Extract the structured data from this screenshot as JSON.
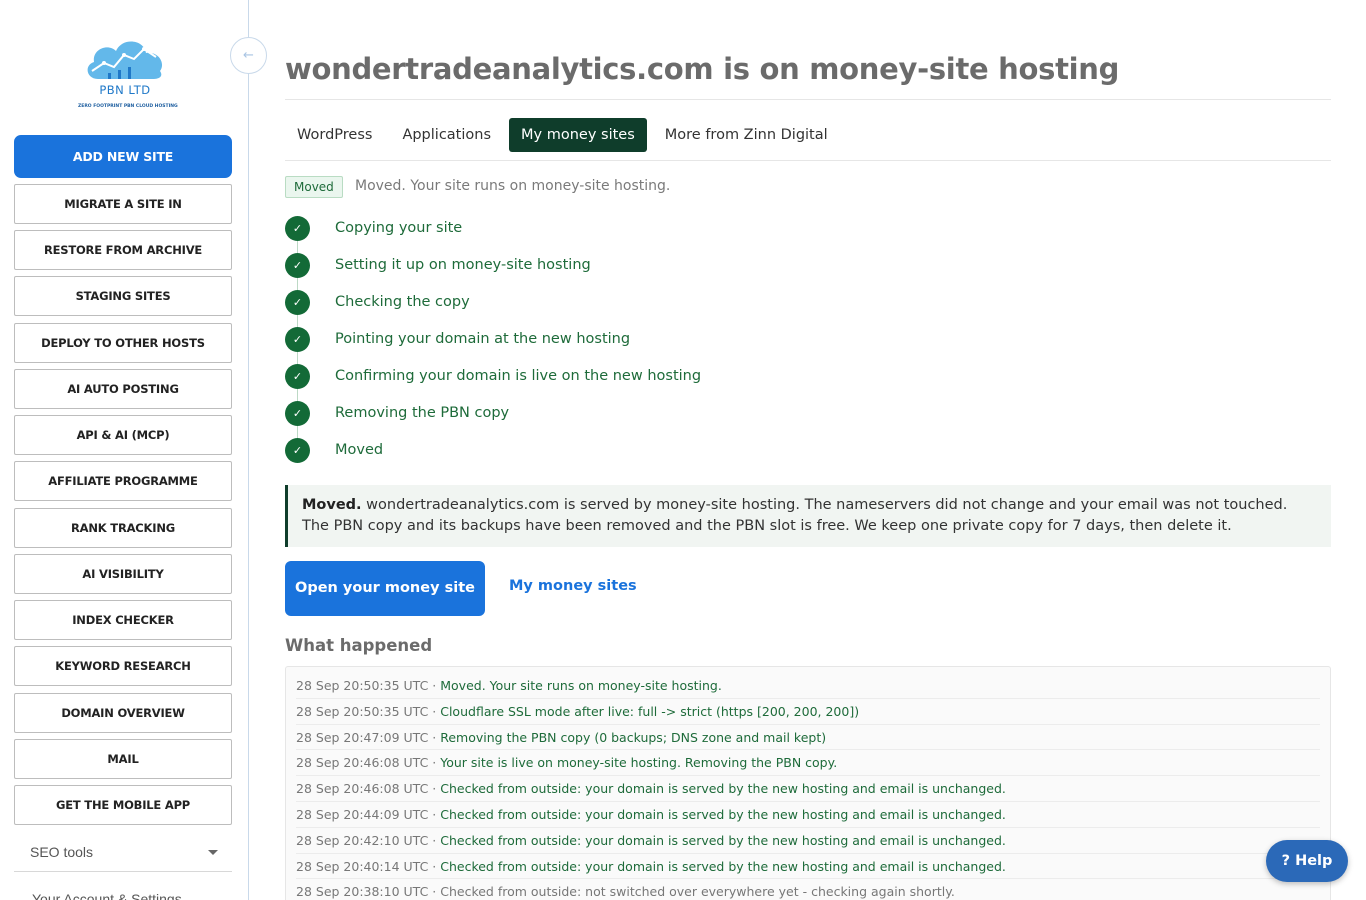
{
  "brand": {
    "name": "PBN LTD",
    "tagline": "ZERO FOOTPRINT PBN CLOUD HOSTING"
  },
  "sidebar": {
    "collapse_icon": "←",
    "primary_button": "ADD NEW SITE",
    "buttons": [
      "MIGRATE A SITE IN",
      "RESTORE FROM ARCHIVE",
      "STAGING SITES",
      "DEPLOY TO OTHER HOSTS",
      "AI AUTO POSTING",
      "API & AI (MCP)",
      "AFFILIATE PROGRAMME",
      "RANK TRACKING",
      "AI VISIBILITY",
      "INDEX CHECKER",
      "KEYWORD RESEARCH",
      "DOMAIN OVERVIEW",
      "MAIL",
      "GET THE MOBILE APP"
    ],
    "seo_tools_label": "SEO tools",
    "account_settings_label": "Your Account & Settings"
  },
  "main": {
    "title": "wondertradeanalytics.com is on money-site hosting",
    "tabs": [
      {
        "label": "WordPress",
        "active": false
      },
      {
        "label": "Applications",
        "active": false
      },
      {
        "label": "My money sites",
        "active": true
      },
      {
        "label": "More from Zinn Digital",
        "active": false
      }
    ],
    "status_badge": "Moved",
    "status_text": "Moved. Your site runs on money-site hosting.",
    "steps": [
      "Copying your site",
      "Setting it up on money-site hosting",
      "Checking the copy",
      "Pointing your domain at the new hosting",
      "Confirming your domain is live on the new hosting",
      "Removing the PBN copy",
      "Moved"
    ],
    "check_icon": "✓",
    "notice": {
      "strong": "Moved.",
      "text": " wondertradeanalytics.com is served by money-site hosting. The nameservers did not change and your email was not touched. The PBN copy and its backups have been removed and the PBN slot is free. We keep one private copy for 7 days, then delete it."
    },
    "cta_label": "Open your money site",
    "cta_link_label": "My money sites",
    "what_happened_title": "What happened",
    "log": [
      {
        "ts": "28 Sep 20:50:35 UTC · ",
        "msg": "Moved. Your site runs on money-site hosting."
      },
      {
        "ts": "28 Sep 20:50:35 UTC · ",
        "msg": "Cloudflare SSL mode after live: full -> strict (https [200, 200, 200])"
      },
      {
        "ts": "28 Sep 20:47:09 UTC · ",
        "msg": "Removing the PBN copy (0 backups; DNS zone and mail kept)"
      },
      {
        "ts": "28 Sep 20:46:08 UTC · ",
        "msg": "Your site is live on money-site hosting. Removing the PBN copy."
      },
      {
        "ts": "28 Sep 20:46:08 UTC · ",
        "msg": "Checked from outside: your domain is served by the new hosting and email is unchanged."
      },
      {
        "ts": "28 Sep 20:44:09 UTC · ",
        "msg": "Checked from outside: your domain is served by the new hosting and email is unchanged."
      },
      {
        "ts": "28 Sep 20:42:10 UTC · ",
        "msg": "Checked from outside: your domain is served by the new hosting and email is unchanged."
      },
      {
        "ts": "28 Sep 20:40:14 UTC · ",
        "msg": "Checked from outside: your domain is served by the new hosting and email is unchanged."
      },
      {
        "ts": "28 Sep 20:38:10 UTC · ",
        "msg": "Checked from outside: not switched over everywhere yet - checking again shortly.",
        "muted": true
      }
    ]
  },
  "help_label": "? Help",
  "colors": {
    "primary": "#1a73dc",
    "active_tab": "#0f3d2b",
    "success": "#136a37"
  }
}
